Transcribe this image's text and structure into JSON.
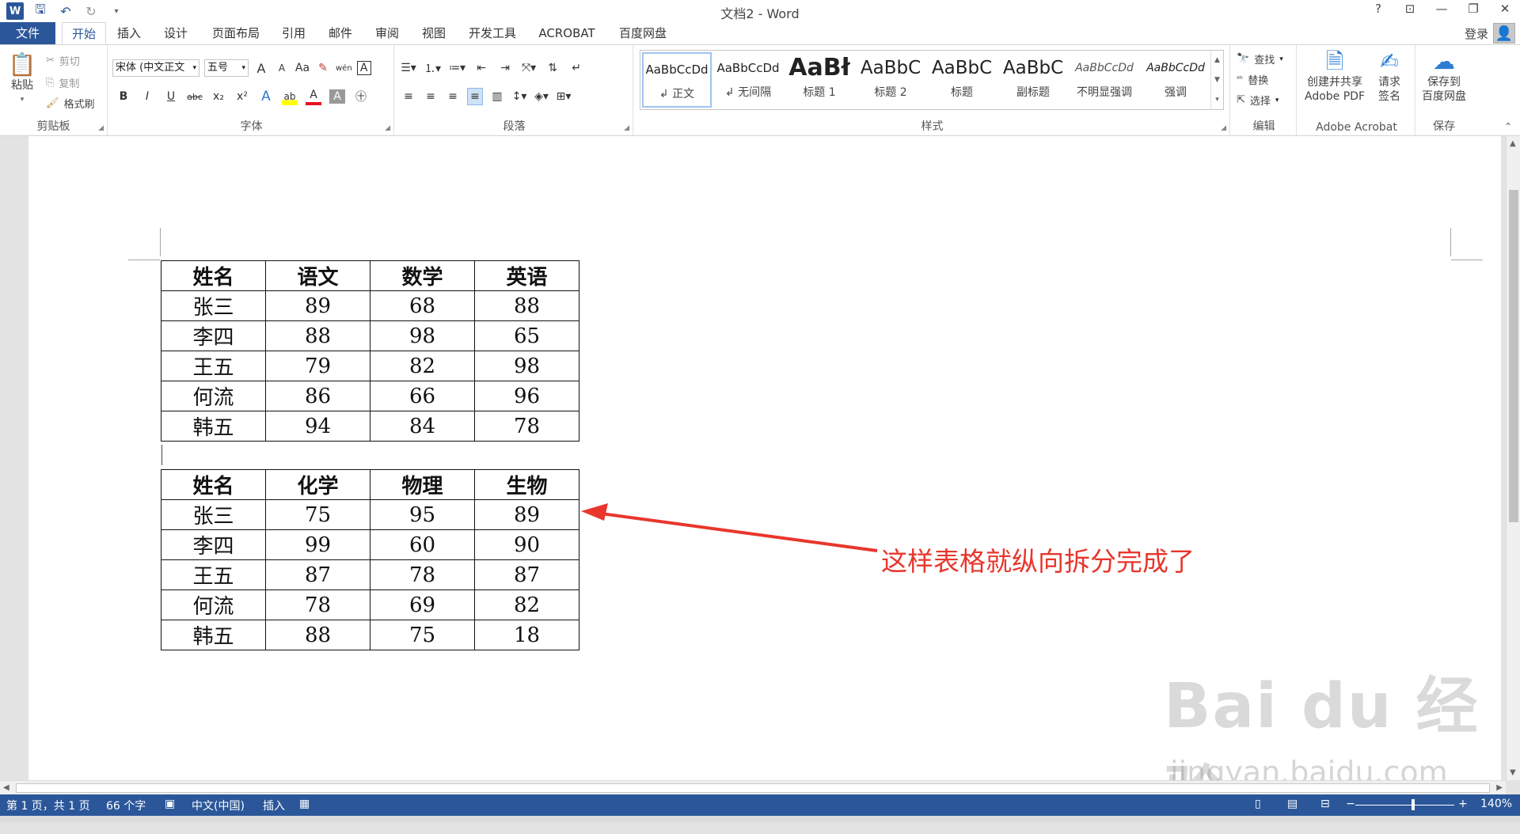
{
  "window": {
    "title": "文档2 - Word",
    "controls": [
      "?",
      "⊡",
      "—",
      "❐",
      "✕"
    ]
  },
  "quick_access": {
    "save_icon": "save-icon",
    "undo_icon": "undo-icon",
    "redo_icon": "redo-icon"
  },
  "tabs": [
    {
      "label": "文件"
    },
    {
      "label": "开始"
    },
    {
      "label": "插入"
    },
    {
      "label": "设计"
    },
    {
      "label": "页面布局"
    },
    {
      "label": "引用"
    },
    {
      "label": "邮件"
    },
    {
      "label": "审阅"
    },
    {
      "label": "视图"
    },
    {
      "label": "开发工具"
    },
    {
      "label": "ACROBAT"
    },
    {
      "label": "百度网盘"
    }
  ],
  "account": {
    "login": "登录"
  },
  "clipboard": {
    "paste": "粘贴",
    "cut": "剪切",
    "copy": "复制",
    "format_painter": "格式刷",
    "label": "剪贴板"
  },
  "font": {
    "name": "宋体 (中文正文",
    "size": "五号",
    "label": "字体",
    "bold": "B",
    "italic": "I",
    "underline": "U",
    "strike": "abc",
    "sub": "x₂",
    "sup": "x²",
    "grow": "A",
    "shrink": "A",
    "case": "Aa",
    "clear": "✎",
    "phonetic": "wén",
    "border": "A",
    "effect": "A",
    "highlight": "ab",
    "color": "A",
    "shade": "A",
    "enclose": "㊉"
  },
  "paragraph": {
    "label": "段落"
  },
  "styles": {
    "label": "样式",
    "items": [
      {
        "sample": "AaBbCcDd",
        "name": "↲ 正文"
      },
      {
        "sample": "AaBbCcDd",
        "name": "↲ 无间隔"
      },
      {
        "sample": "AaBł",
        "name": "标题 1"
      },
      {
        "sample": "AaBbC",
        "name": "标题 2"
      },
      {
        "sample": "AaBbC",
        "name": "标题"
      },
      {
        "sample": "AaBbC",
        "name": "副标题"
      },
      {
        "sample": "AaBbCcDd",
        "name": "不明显强调"
      },
      {
        "sample": "AaBbCcDd",
        "name": "强调"
      }
    ]
  },
  "editing": {
    "find": "查找",
    "replace": "替换",
    "select": "选择",
    "label": "编辑"
  },
  "acrobat": {
    "create_line1": "创建并共享",
    "create_line2": "Adobe PDF",
    "sign_line1": "请求",
    "sign_line2": "签名",
    "label": "Adobe Acrobat"
  },
  "save_group": {
    "line1": "保存到",
    "line2": "百度网盘",
    "label": "保存"
  },
  "table1": {
    "header": [
      "姓名",
      "语文",
      "数学",
      "英语"
    ],
    "rows": [
      [
        "张三",
        "89",
        "68",
        "88"
      ],
      [
        "李四",
        "88",
        "98",
        "65"
      ],
      [
        "王五",
        "79",
        "82",
        "98"
      ],
      [
        "何流",
        "86",
        "66",
        "96"
      ],
      [
        "韩五",
        "94",
        "84",
        "78"
      ]
    ]
  },
  "table2": {
    "header": [
      "姓名",
      "化学",
      "物理",
      "生物"
    ],
    "rows": [
      [
        "张三",
        "75",
        "95",
        "89"
      ],
      [
        "李四",
        "99",
        "60",
        "90"
      ],
      [
        "王五",
        "87",
        "78",
        "87"
      ],
      [
        "何流",
        "78",
        "69",
        "82"
      ],
      [
        "韩五",
        "88",
        "75",
        "18"
      ]
    ]
  },
  "annotation": {
    "text": "这样表格就纵向拆分完成了",
    "color": "#e8362c"
  },
  "watermark": {
    "main": "Bai du 经验",
    "sub": "jingyan.baidu.com"
  },
  "status": {
    "page": "第 1 页，共 1 页",
    "words": "66 个字",
    "language": "中文(中国)",
    "mode": "插入",
    "zoom": "140%"
  },
  "colors": {
    "accent": "#2b579a",
    "annotation": "#e8362c"
  }
}
